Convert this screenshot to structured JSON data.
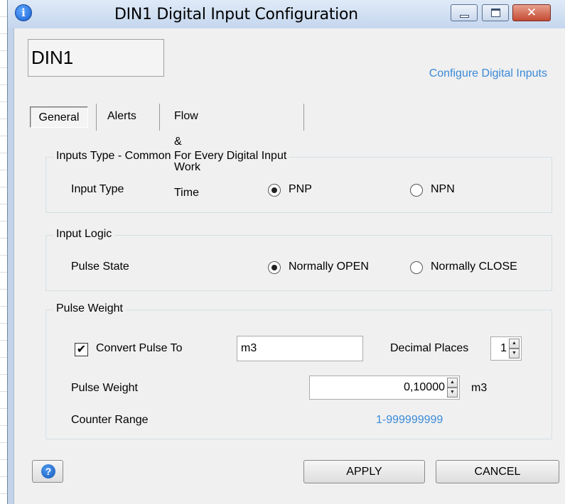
{
  "window": {
    "title": "DIN1 Digital Input Configuration",
    "close_glyph": "✕",
    "info_glyph": "i"
  },
  "header": {
    "name": "DIN1",
    "configure_link": "Configure Digital Inputs"
  },
  "tabs": [
    {
      "label": "General",
      "selected": true
    },
    {
      "label": "Alerts",
      "selected": false
    },
    {
      "label": "Flow & Work Time",
      "selected": false
    }
  ],
  "inputs_type_group": {
    "title": "Inputs Type - Common For Every Digital Input",
    "field_label": "Input Type",
    "options": [
      {
        "label": "PNP",
        "selected": true
      },
      {
        "label": "NPN",
        "selected": false
      }
    ]
  },
  "input_logic_group": {
    "title": "Input Logic",
    "field_label": "Pulse State",
    "options": [
      {
        "label": "Normally OPEN",
        "selected": true
      },
      {
        "label": "Normally CLOSE",
        "selected": false
      }
    ]
  },
  "pulse_weight_group": {
    "title": "Pulse Weight",
    "convert_label": "Convert Pulse To",
    "convert_checked": true,
    "check_glyph": "✔",
    "unit_value": "m3",
    "decimal_label": "Decimal Places",
    "decimal_value": "1",
    "weight_label": "Pulse Weight",
    "weight_value": "0,10000",
    "weight_unit": "m3",
    "range_label": "Counter Range",
    "range_value": "1-999999999"
  },
  "footer": {
    "help_glyph": "?",
    "apply_label": "APPLY",
    "cancel_label": "CANCEL"
  },
  "colors": {
    "link": "#3a8ad8",
    "title_bar": "#c4d6ee",
    "close_button": "#c44a33"
  }
}
